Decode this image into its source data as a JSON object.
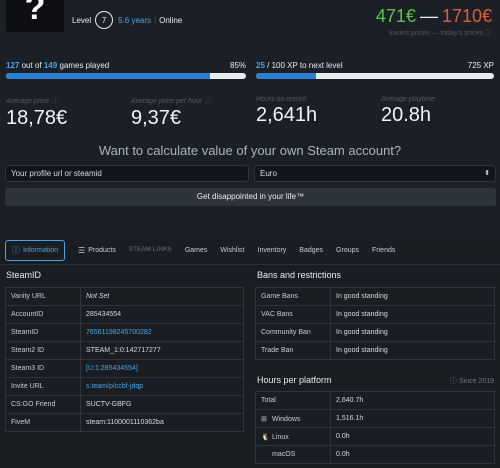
{
  "profile": {
    "avatar_glyph": "?",
    "level_label": "Level",
    "level": "7",
    "years": "5.6 years",
    "status": "Online"
  },
  "prices": {
    "low": "471€",
    "dash": "—",
    "high": "1710€",
    "subtitle": "lowest prices — today's prices",
    "colors": {
      "low": "#5ac34a",
      "high": "#e15b3c"
    }
  },
  "games_progress": {
    "played": "127",
    "out_of_text": "out of",
    "total": "149",
    "suffix": "games played",
    "percent_label": "85%",
    "fraction": 0.85
  },
  "xp_progress": {
    "current": "25",
    "rest": "/ 100 XP to next level",
    "total_xp": "725 XP",
    "fraction": 0.25
  },
  "stats": [
    {
      "label": "Average price",
      "value": "18,78€"
    },
    {
      "label": "Average price per hour",
      "value": "9,37€"
    },
    {
      "label": "Hours on record",
      "value": "2,641h"
    },
    {
      "label": "Average playtime",
      "value": "20.8h"
    }
  ],
  "calculator": {
    "heading": "Want to calculate value of your own Steam account?",
    "input_placeholder": "Your profile url or steamid",
    "currency": "Euro",
    "submit_label": "Get disappointed in your life™"
  },
  "tabs": [
    {
      "label": "Information",
      "active": true
    },
    {
      "label": "Products"
    },
    {
      "label": "STEAM LINKS"
    },
    {
      "label": "Games"
    },
    {
      "label": "Wishlist"
    },
    {
      "label": "Inventory"
    },
    {
      "label": "Badges"
    },
    {
      "label": "Groups"
    },
    {
      "label": "Friends"
    }
  ],
  "steamid": {
    "title": "SteamID",
    "rows": [
      {
        "key": "Vanity URL",
        "value": "Not Set"
      },
      {
        "key": "AccountID",
        "value": "285434554"
      },
      {
        "key": "SteamID",
        "value": "76561198245700282"
      },
      {
        "key": "Steam2 ID",
        "value": "STEAM_1:0:142717277"
      },
      {
        "key": "Steam3 ID",
        "value": "[U:1:285434554]"
      },
      {
        "key": "Invite URL",
        "value": "s.team/p/ccbf-jdqp"
      },
      {
        "key": "CS:GO Friend",
        "value": "SUCTV-GBFG"
      },
      {
        "key": "FiveM",
        "value": "steam:1100001110362ba"
      }
    ]
  },
  "bans": {
    "title": "Bans and restrictions",
    "rows": [
      {
        "key": "Game Bans",
        "value": "In good standing"
      },
      {
        "key": "VAC Bans",
        "value": "In good standing"
      },
      {
        "key": "Community Ban",
        "value": "In good standing"
      },
      {
        "key": "Trade Ban",
        "value": "In good standing"
      }
    ]
  },
  "platforms": {
    "title": "Hours per platform",
    "since": "Since 2019",
    "rows": [
      {
        "key": "Total",
        "value": "2,640.7h"
      },
      {
        "key": "Windows",
        "value": "1,516.1h",
        "icon": "windows-icon"
      },
      {
        "key": "Linux",
        "value": "0.0h",
        "icon": "linux-icon"
      },
      {
        "key": "macOS",
        "value": "0.0h",
        "icon": "apple-icon"
      }
    ]
  }
}
